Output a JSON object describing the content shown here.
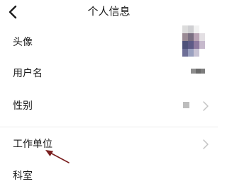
{
  "header": {
    "title": "个人信息",
    "back_icon": "chevron-left-icon"
  },
  "profile_rows": [
    {
      "label": "头像",
      "value_type": "avatar-image",
      "has_chevron": false
    },
    {
      "label": "用户名",
      "value_type": "blurred-text",
      "has_chevron": false
    },
    {
      "label": "性别",
      "value_type": "blurred-text",
      "has_chevron": true
    },
    {
      "label": "工作单位",
      "value_type": "empty",
      "has_chevron": true
    },
    {
      "label": "科室",
      "value_type": "empty",
      "has_chevron": false
    }
  ],
  "annotation": {
    "type": "arrow",
    "points_to": "工作单位",
    "color": "#7a1f1f"
  },
  "colors": {
    "text": "#1a1a1a",
    "chevron": "#c4c4c4",
    "separator": "#ececec",
    "background": "#ffffff"
  }
}
